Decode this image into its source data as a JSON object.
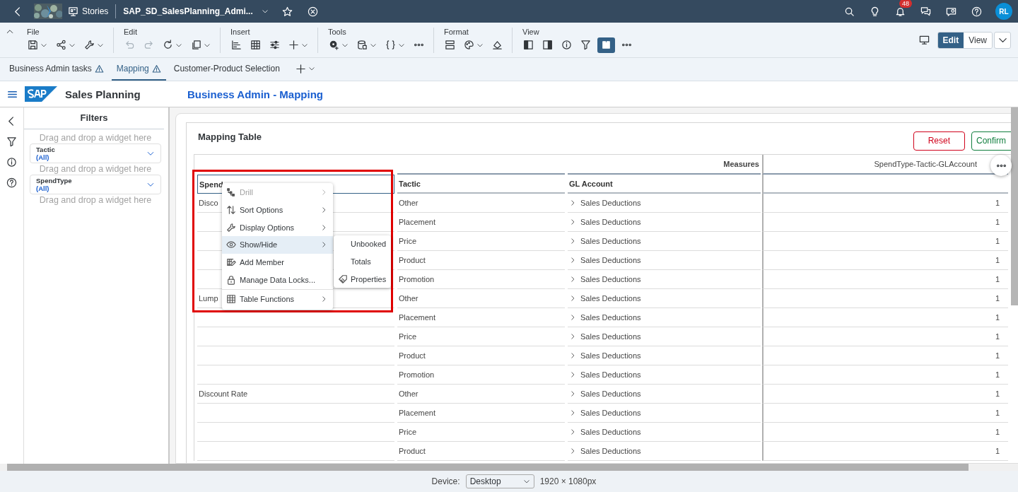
{
  "shell": {
    "nav_label": "Stories",
    "title": "SAP_SD_SalesPlanning_Admi...",
    "notification_count": "48",
    "avatar": "RL"
  },
  "toolbar": {
    "groups": [
      {
        "label": "File",
        "items": [
          {
            "dropdown": true,
            "disabled": false,
            "on": false
          },
          {
            "dropdown": true,
            "disabled": false,
            "on": false
          },
          {
            "dropdown": true,
            "disabled": false,
            "on": false
          }
        ]
      },
      {
        "label": "Edit",
        "items": [
          {
            "dropdown": false,
            "disabled": true,
            "on": false
          },
          {
            "dropdown": false,
            "disabled": true,
            "on": false
          },
          {
            "dropdown": true,
            "disabled": false,
            "on": false
          },
          {
            "dropdown": true,
            "disabled": false,
            "on": false
          }
        ]
      },
      {
        "label": "Insert",
        "items": [
          {
            "dropdown": false,
            "disabled": false,
            "on": false
          },
          {
            "dropdown": false,
            "disabled": false,
            "on": false
          },
          {
            "dropdown": false,
            "disabled": false,
            "on": false
          },
          {
            "dropdown": true,
            "disabled": false,
            "on": false
          }
        ]
      },
      {
        "label": "Tools",
        "items": [
          {
            "dropdown": true,
            "disabled": false,
            "on": false
          },
          {
            "dropdown": true,
            "disabled": false,
            "on": false
          },
          {
            "dropdown": true,
            "disabled": false,
            "on": false
          },
          {
            "dropdown": false,
            "disabled": false,
            "on": false
          }
        ]
      },
      {
        "label": "Format",
        "items": [
          {
            "dropdown": false,
            "disabled": false,
            "on": false
          },
          {
            "dropdown": true,
            "disabled": false,
            "on": false
          },
          {
            "dropdown": false,
            "disabled": false,
            "on": false
          }
        ]
      },
      {
        "label": "View",
        "items": [
          {
            "dropdown": false,
            "disabled": false,
            "on": false
          },
          {
            "dropdown": false,
            "disabled": false,
            "on": false
          },
          {
            "dropdown": false,
            "disabled": false,
            "on": false
          },
          {
            "dropdown": false,
            "disabled": false,
            "on": false
          },
          {
            "dropdown": false,
            "disabled": false,
            "on": true
          },
          {
            "dropdown": false,
            "disabled": false,
            "on": false
          }
        ]
      }
    ]
  },
  "mode_buttons": [
    {
      "label": "Edit",
      "selected": true
    },
    {
      "label": "View",
      "selected": false
    }
  ],
  "page_tabs": [
    {
      "label": "Business Admin tasks",
      "warning": true,
      "selected": false
    },
    {
      "label": "Mapping",
      "warning": true,
      "selected": true
    },
    {
      "label": "Customer-Product Selection",
      "warning": false,
      "selected": false
    }
  ],
  "story": {
    "title": "Sales Planning",
    "page_title": "Business Admin - Mapping"
  },
  "filters": {
    "title": "Filters",
    "slots": [
      {
        "kind": "hint",
        "text": "Drag and drop a widget here"
      },
      {
        "kind": "filter",
        "label": "Tactic",
        "value": "(All)"
      },
      {
        "kind": "hint",
        "text": "Drag and drop a widget here"
      },
      {
        "kind": "filter",
        "label": "SpendType",
        "value": "(All)"
      },
      {
        "kind": "hint",
        "text": "Drag and drop a widget here"
      }
    ]
  },
  "widget": {
    "title": "Mapping Table",
    "buttons": [
      {
        "label": "Reset",
        "kind": "reset"
      },
      {
        "label": "Confirm",
        "kind": "confirm"
      }
    ],
    "table": {
      "measures_label": "Measures",
      "value_header": "SpendType-Tactic-GLAccount",
      "columns": [
        {
          "label": "Spend",
          "selected": true
        },
        {
          "label": "Tactic",
          "selected": false
        },
        {
          "label": "GL Account",
          "selected": false
        }
      ],
      "rows": [
        {
          "spend_type": "Disco",
          "tactic": "Other",
          "gl_account": "Sales Deductions",
          "value": "1"
        },
        {
          "tactic": "Placement",
          "gl_account": "Sales Deductions",
          "value": "1"
        },
        {
          "tactic": "Price",
          "gl_account": "Sales Deductions",
          "value": "1"
        },
        {
          "tactic": "Product",
          "gl_account": "Sales Deductions",
          "value": "1"
        },
        {
          "tactic": "Promotion",
          "gl_account": "Sales Deductions",
          "value": "1"
        },
        {
          "spend_type": "Lump",
          "tactic": "Other",
          "gl_account": "Sales Deductions",
          "value": "1"
        },
        {
          "tactic": "Placement",
          "gl_account": "Sales Deductions",
          "value": "1"
        },
        {
          "tactic": "Price",
          "gl_account": "Sales Deductions",
          "value": "1"
        },
        {
          "tactic": "Product",
          "gl_account": "Sales Deductions",
          "value": "1"
        },
        {
          "tactic": "Promotion",
          "gl_account": "Sales Deductions",
          "value": "1"
        },
        {
          "spend_type": "Discount Rate",
          "tactic": "Other",
          "gl_account": "Sales Deductions",
          "value": "1"
        },
        {
          "tactic": "Placement",
          "gl_account": "Sales Deductions",
          "value": "1"
        },
        {
          "tactic": "Price",
          "gl_account": "Sales Deductions",
          "value": "1"
        },
        {
          "tactic": "Product",
          "gl_account": "Sales Deductions",
          "value": "1"
        }
      ]
    }
  },
  "context_menu": {
    "items": [
      {
        "label": "Drill",
        "disabled": true,
        "submenu": true,
        "selected": false,
        "divider": false
      },
      {
        "label": "Sort Options",
        "disabled": false,
        "submenu": true,
        "selected": false,
        "divider": false
      },
      {
        "label": "Display Options",
        "disabled": false,
        "submenu": true,
        "selected": false,
        "divider": false
      },
      {
        "label": "Show/Hide",
        "disabled": false,
        "submenu": true,
        "selected": true,
        "divider": false
      },
      {
        "label": "Add Member",
        "disabled": false,
        "submenu": false,
        "selected": false,
        "divider": false
      },
      {
        "label": "Manage Data Locks...",
        "disabled": false,
        "submenu": false,
        "selected": false,
        "divider": false
      },
      {
        "label": "Table Functions",
        "disabled": false,
        "submenu": true,
        "selected": false,
        "divider": true
      }
    ],
    "submenu": {
      "items": [
        {
          "label": "Unbooked",
          "kind": "text"
        },
        {
          "label": "Totals",
          "kind": "text"
        },
        {
          "label": "Properties",
          "kind": "with_icon"
        }
      ]
    }
  },
  "footer": {
    "device_label": "Device:",
    "device": "Desktop",
    "resolution": "1920 × 1080px"
  }
}
